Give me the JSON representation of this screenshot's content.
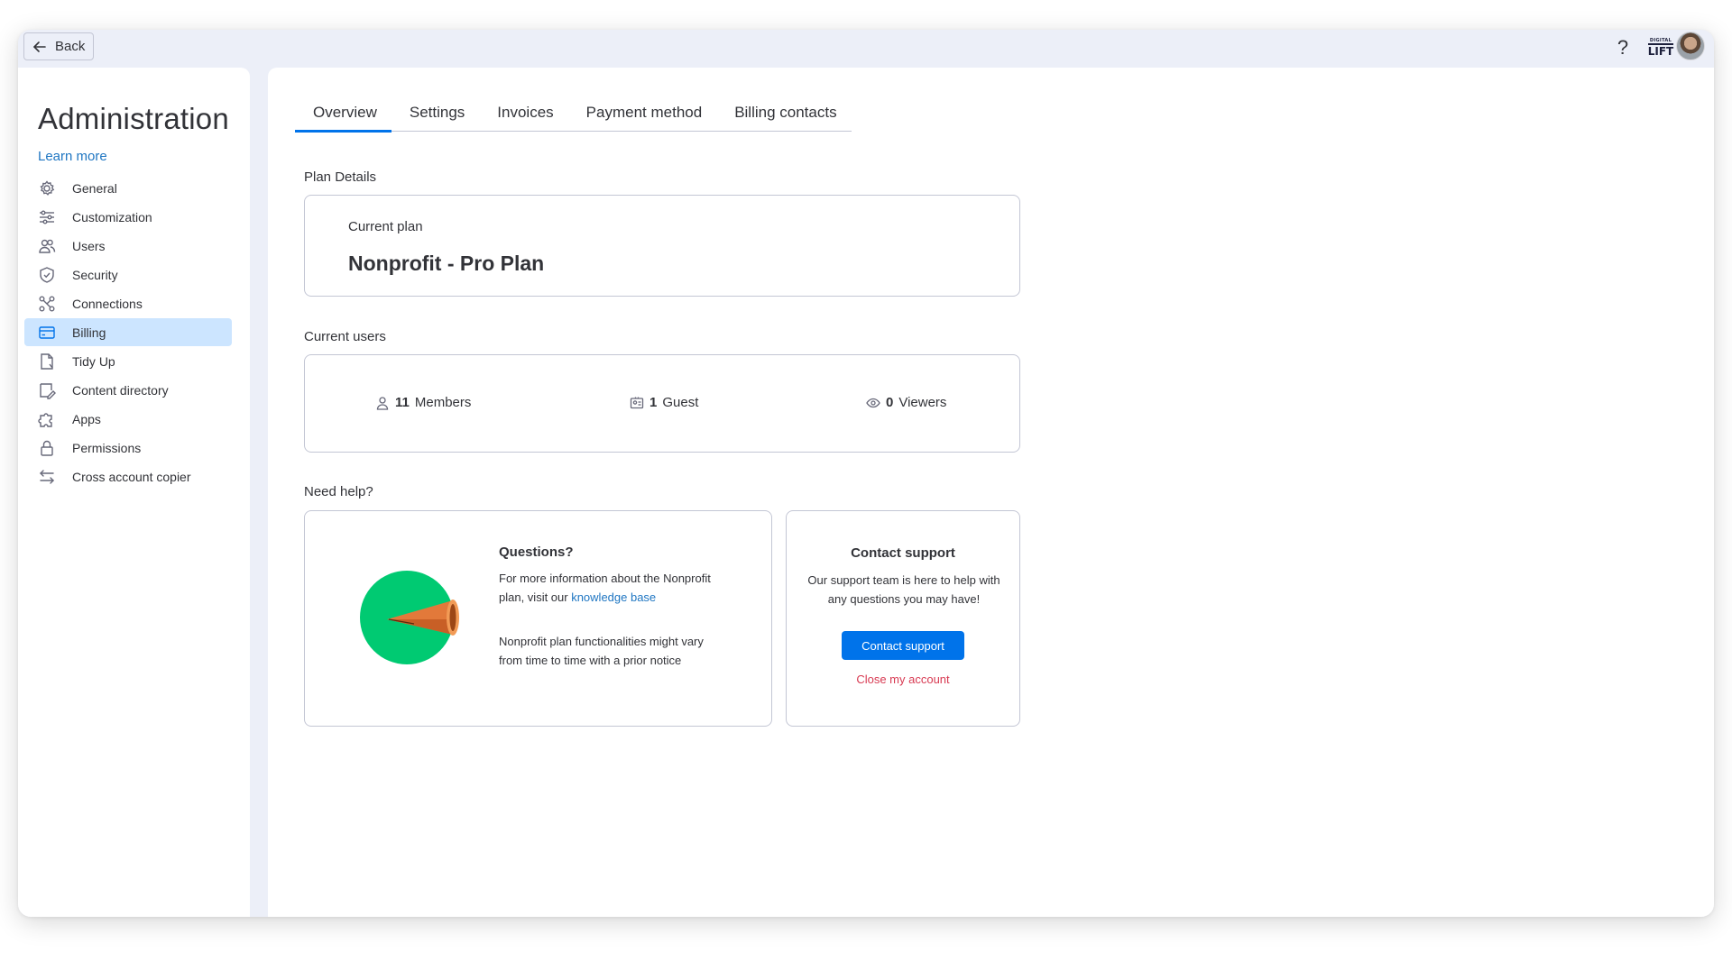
{
  "topbar": {
    "back_label": "Back",
    "help_label": "?",
    "brand_small": "DIGITAL",
    "brand_big": "LIFT"
  },
  "sidebar": {
    "title": "Administration",
    "learn_more": "Learn more",
    "items": [
      {
        "label": "General",
        "icon": "gear-icon"
      },
      {
        "label": "Customization",
        "icon": "sliders-icon"
      },
      {
        "label": "Users",
        "icon": "users-icon"
      },
      {
        "label": "Security",
        "icon": "shield-icon"
      },
      {
        "label": "Connections",
        "icon": "connections-icon"
      },
      {
        "label": "Billing",
        "icon": "credit-card-icon",
        "active": true
      },
      {
        "label": "Tidy Up",
        "icon": "tidy-up-icon"
      },
      {
        "label": "Content directory",
        "icon": "content-directory-icon"
      },
      {
        "label": "Apps",
        "icon": "puzzle-icon"
      },
      {
        "label": "Permissions",
        "icon": "lock-icon"
      },
      {
        "label": "Cross account copier",
        "icon": "swap-arrows-icon"
      }
    ]
  },
  "tabs": [
    {
      "label": "Overview",
      "active": true
    },
    {
      "label": "Settings"
    },
    {
      "label": "Invoices"
    },
    {
      "label": "Payment method"
    },
    {
      "label": "Billing contacts"
    }
  ],
  "plan": {
    "section_label": "Plan Details",
    "current_label": "Current plan",
    "name": "Nonprofit - Pro Plan"
  },
  "current_users": {
    "section_label": "Current users",
    "members_count": "11",
    "members_label": "Members",
    "guest_count": "1",
    "guest_label": "Guest",
    "viewers_count": "0",
    "viewers_label": "Viewers"
  },
  "help": {
    "section_label": "Need help?",
    "questions_title": "Questions?",
    "questions_text_prefix": "For more information about the Nonprofit plan, visit our ",
    "questions_link": "knowledge base",
    "questions_note": "Nonprofit plan functionalities might vary from time to time with a prior notice",
    "support_title": "Contact support",
    "support_text": "Our support team is here to help with any questions you may have!",
    "support_button": "Contact support",
    "close_account": "Close my account"
  },
  "colors": {
    "accent": "#0073ea",
    "active_nav": "#cce5ff",
    "link": "#1f76c2",
    "danger": "#d83a52",
    "illustration_green": "#00ca72"
  }
}
